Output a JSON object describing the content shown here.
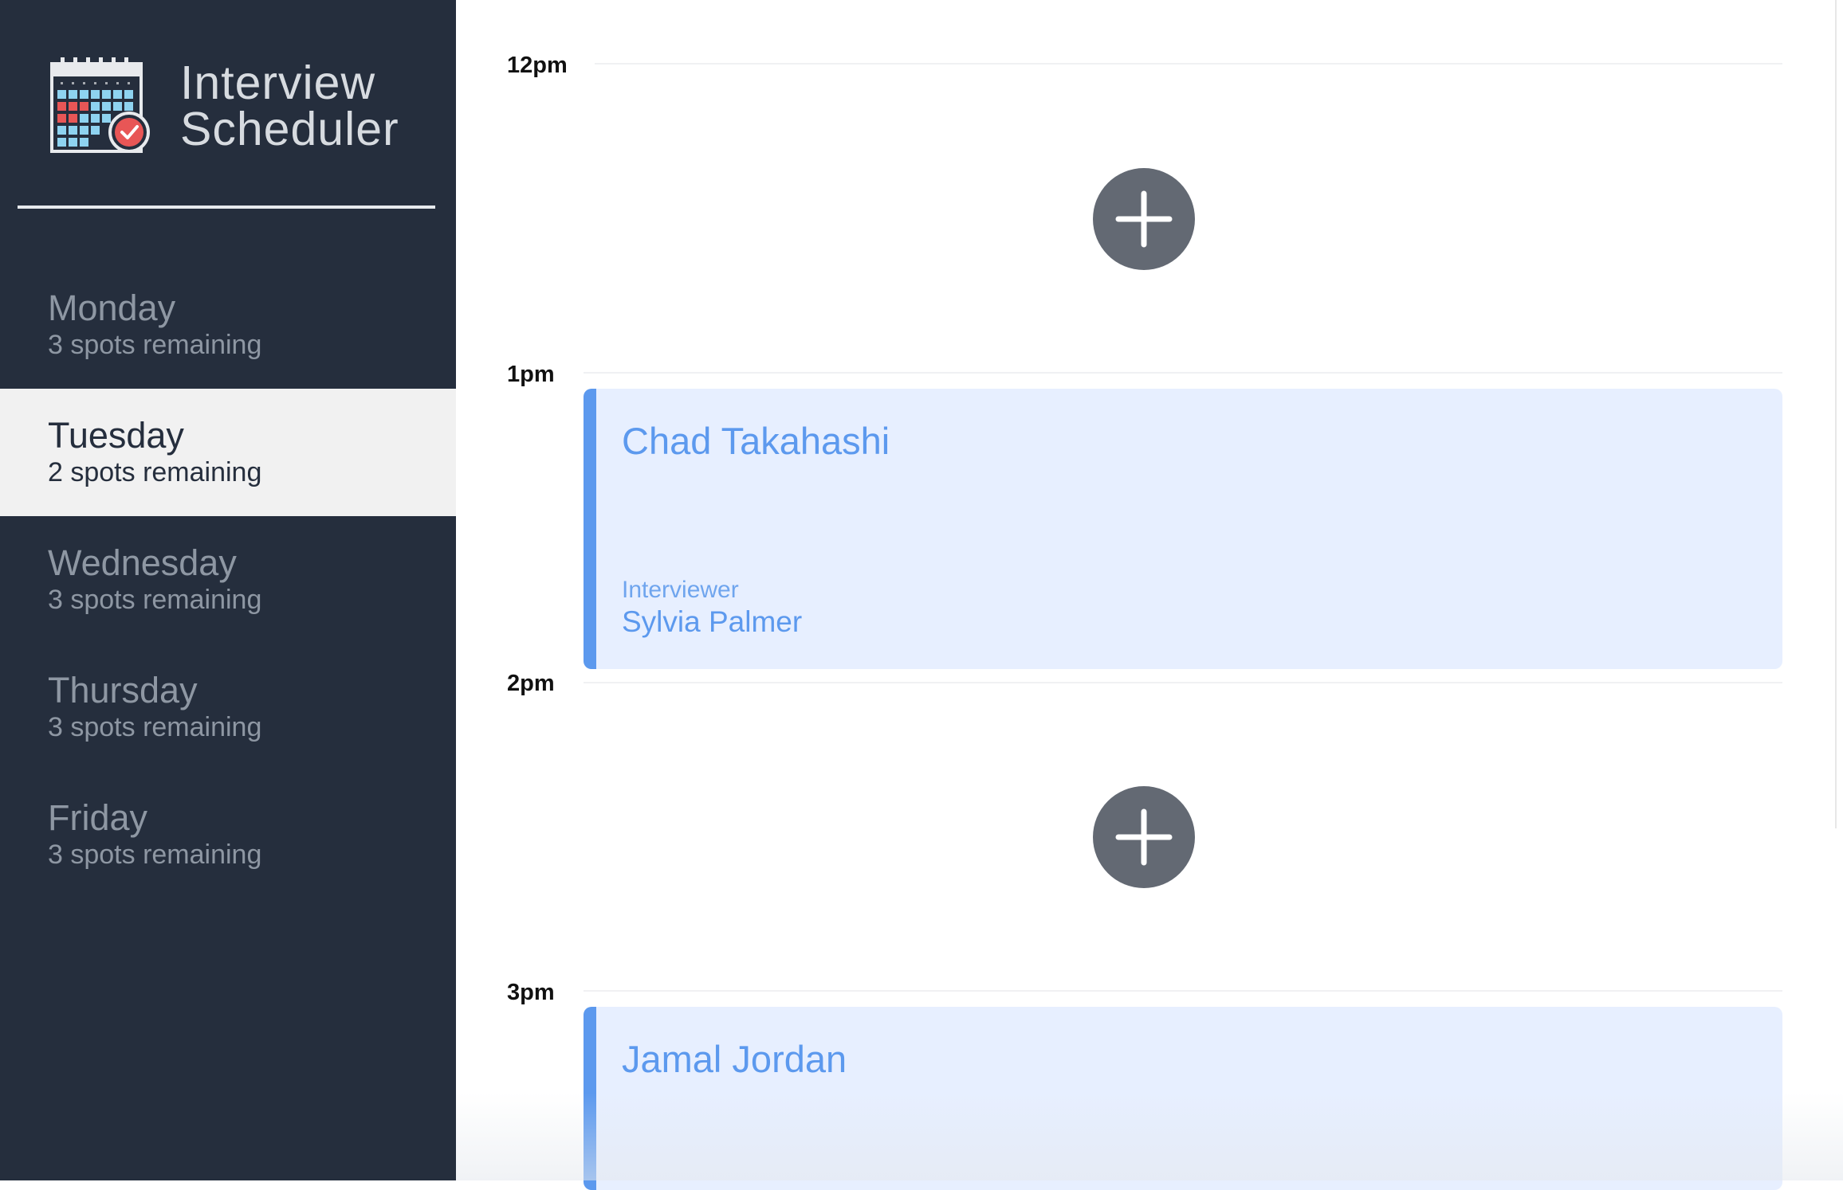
{
  "app": {
    "title_line1": "Interview",
    "title_line2": "Scheduler",
    "logo_icon": "calendar-check-icon"
  },
  "days": [
    {
      "name": "Monday",
      "spots": "3 spots remaining",
      "selected": false
    },
    {
      "name": "Tuesday",
      "spots": "2 spots remaining",
      "selected": true
    },
    {
      "name": "Wednesday",
      "spots": "3 spots remaining",
      "selected": false
    },
    {
      "name": "Thursday",
      "spots": "3 spots remaining",
      "selected": false
    },
    {
      "name": "Friday",
      "spots": "3 spots remaining",
      "selected": false
    }
  ],
  "schedule": {
    "slots": [
      {
        "time": "12pm",
        "appointment": null
      },
      {
        "time": "1pm",
        "appointment": {
          "student": "Chad Takahashi",
          "interviewer_label": "Interviewer",
          "interviewer": "Sylvia Palmer"
        }
      },
      {
        "time": "2pm",
        "appointment": null
      },
      {
        "time": "3pm",
        "appointment": {
          "student": "Jamal Jordan"
        }
      }
    ],
    "add_icon": "plus-icon"
  },
  "colors": {
    "sidebar_bg": "#252e3d",
    "selected_day_bg": "#f1f1f1",
    "appointment_bg": "#e7efff",
    "appointment_accent": "#5c99ee",
    "add_button": "#636973"
  }
}
